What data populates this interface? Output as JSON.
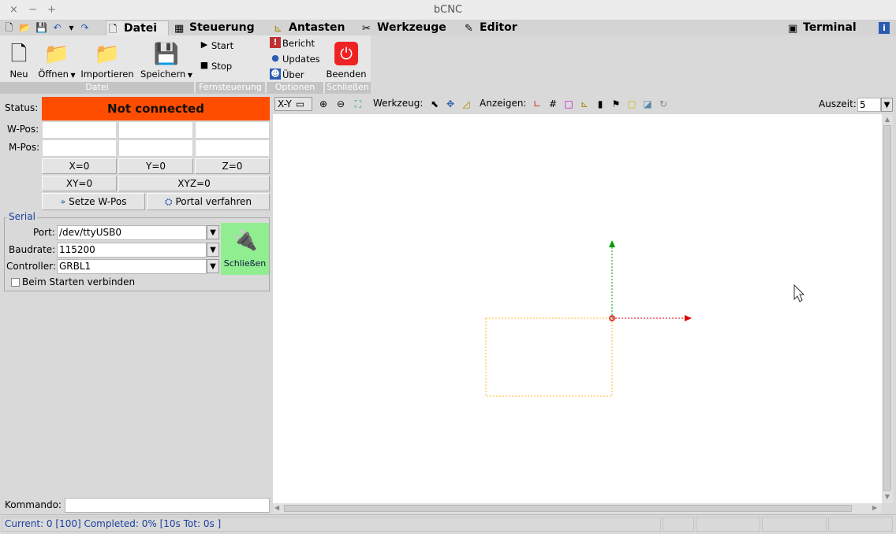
{
  "window": {
    "title": "bCNC",
    "controls": [
      "×",
      "−",
      "+"
    ]
  },
  "tabs": {
    "datei": "Datei",
    "steuerung": "Steuerung",
    "antasten": "Antasten",
    "werkzeuge": "Werkzeuge",
    "editor": "Editor",
    "terminal": "Terminal"
  },
  "ribbon": {
    "neu": "Neu",
    "oeffnen": "Öffnen",
    "importieren": "Importieren",
    "speichern": "Speichern",
    "start": "Start",
    "stop": "Stop",
    "bericht": "Bericht",
    "updates": "Updates",
    "ueber": "Über",
    "beenden": "Beenden",
    "groups": {
      "datei": "Datei",
      "fernsteuerung": "Fernsteuerung",
      "optionen": "Optionen",
      "schliessen": "Schließen"
    }
  },
  "state": {
    "status_label": "Status:",
    "status_value": "Not connected",
    "status_color": "#ff4d00",
    "wpos_label": "W-Pos:",
    "mpos_label": "M-Pos:",
    "buttons": {
      "x0": "X=0",
      "y0": "Y=0",
      "z0": "Z=0",
      "xy0": "XY=0",
      "xyz0": "XYZ=0",
      "setze_wpos": "Setze W-Pos",
      "portal": "Portal verfahren"
    }
  },
  "serial": {
    "legend": "Serial",
    "port_label": "Port:",
    "port_value": "/dev/ttyUSB0",
    "baud_label": "Baudrate:",
    "baud_value": "115200",
    "controller_label": "Controller:",
    "controller_value": "GRBL1",
    "connect_button": "Schließen",
    "connect_color": "#90ee90",
    "autoconnect_label": "Beim Starten verbinden",
    "autoconnect_checked": false
  },
  "command": {
    "label": "Kommando:",
    "value": ""
  },
  "canvas_toolbar": {
    "view": "X-Y",
    "werkzeug_label": "Werkzeug:",
    "anzeigen_label": "Anzeigen:",
    "auszeit_label": "Auszeit:",
    "auszeit_value": "5"
  },
  "statusbar": {
    "text": "Current: 0 [100]  Completed: 0% [10s Tot: 0s ]"
  }
}
